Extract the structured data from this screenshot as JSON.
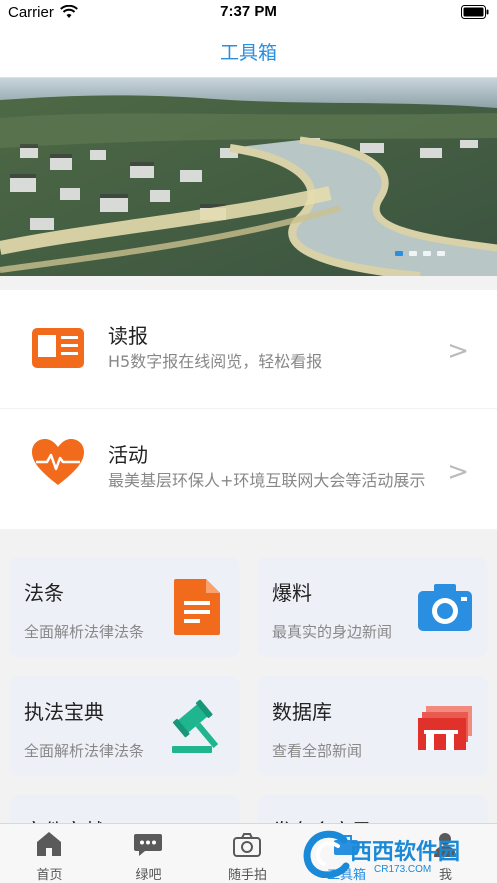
{
  "status_bar": {
    "carrier": "Carrier",
    "time": "7:37 PM"
  },
  "nav": {
    "title": "工具箱"
  },
  "banner": {
    "dot_count": 4,
    "active_dot": 0
  },
  "list_items": [
    {
      "title": "读报",
      "subtitle": "H5数字报在线阅览，轻松看报",
      "icon": "newspaper-icon",
      "arrow": ">"
    },
    {
      "title": "活动",
      "subtitle": "最美基层环保人+环境互联网大会等活动展示",
      "icon": "heartbeat-icon",
      "arrow": ">"
    }
  ],
  "tiles": [
    {
      "title": "法条",
      "subtitle": "全面解析法律法条",
      "icon": "document-icon"
    },
    {
      "title": "爆料",
      "subtitle": "最真实的身边新闻",
      "icon": "camera-icon"
    },
    {
      "title": "执法宝典",
      "subtitle": "全面解析法律法条",
      "icon": "gavel-icon"
    },
    {
      "title": "数据库",
      "subtitle": "查看全部新闻",
      "icon": "database-icon"
    },
    {
      "title": "文件文献",
      "subtitle": "",
      "icon": "folder-icon"
    },
    {
      "title": "发布会实录",
      "subtitle": "",
      "icon": "mic-icon"
    }
  ],
  "tabs": [
    {
      "label": "首页",
      "icon": "home-icon",
      "active": false
    },
    {
      "label": "绿吧",
      "icon": "chat-icon",
      "active": false
    },
    {
      "label": "随手拍",
      "icon": "camera-tab-icon",
      "active": false
    },
    {
      "label": "工具箱",
      "icon": "toolbox-icon",
      "active": true
    },
    {
      "label": "我",
      "icon": "user-icon",
      "active": false
    }
  ],
  "watermark": {
    "text": "西西软件园",
    "sub": "CR173.COM"
  },
  "colors": {
    "accent": "#2b8fe0",
    "orange": "#f26a1b",
    "red": "#e0312a",
    "teal": "#1fb58f",
    "blue": "#2a8fe0"
  }
}
